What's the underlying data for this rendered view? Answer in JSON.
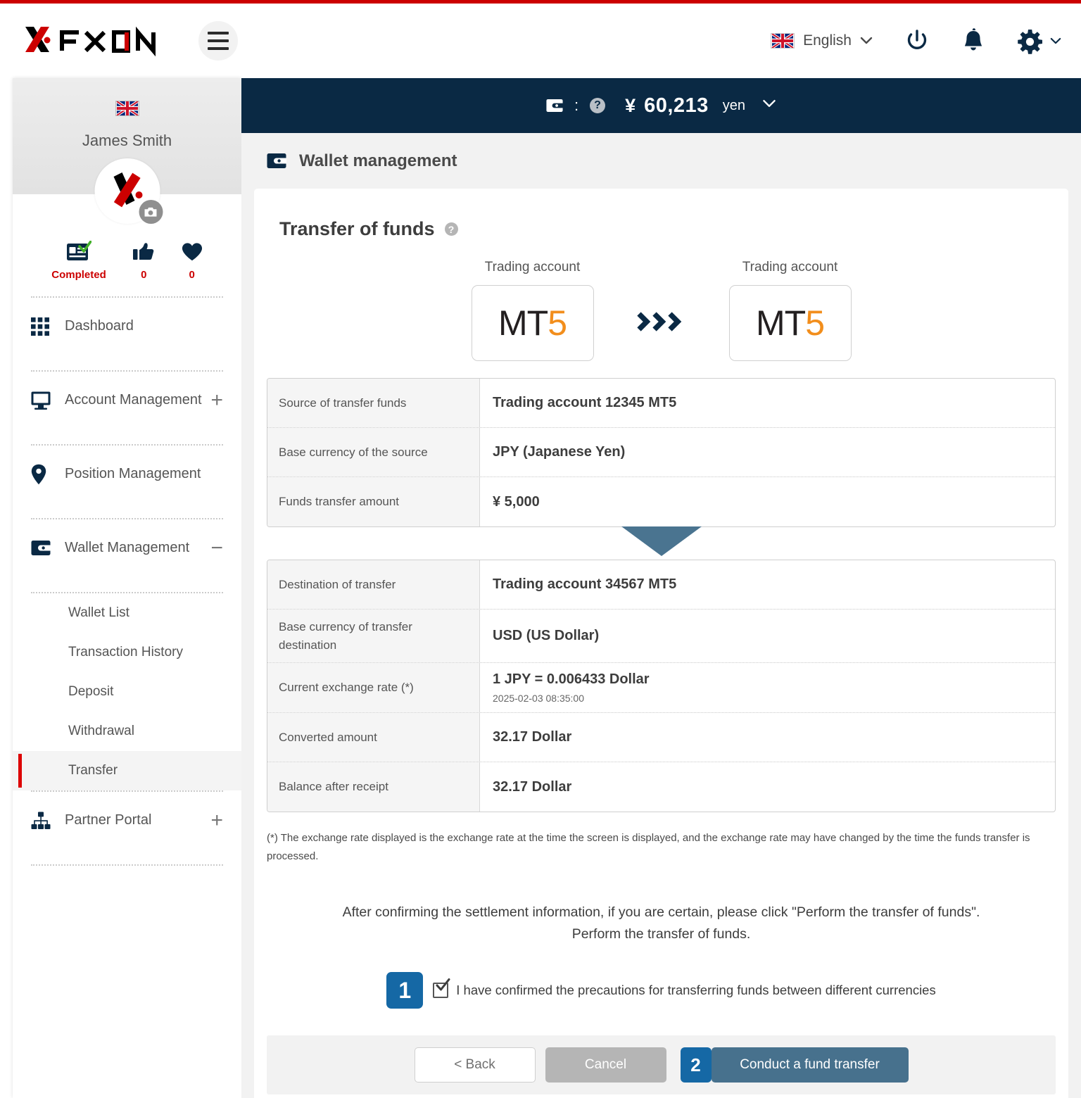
{
  "header": {
    "logo_text": "FXON",
    "menu_icon": "hamburger-icon",
    "language": "English",
    "power_icon": "power-icon",
    "bell_icon": "bell-icon",
    "gear_icon": "gear-icon",
    "flag_icon": "uk-flag-icon"
  },
  "sidebar": {
    "user_name": "James Smith",
    "user_flag": "uk-flag-icon",
    "avatar_icon": "fxon-avatar-icon",
    "camera_icon": "camera-icon",
    "stats": [
      {
        "icon": "id-card-check-icon",
        "label": "Completed"
      },
      {
        "icon": "thumbs-up-icon",
        "label": "0"
      },
      {
        "icon": "heart-icon",
        "label": "0"
      }
    ],
    "nav": [
      {
        "label": "Dashboard",
        "icon": "grid-icon",
        "toggle": ""
      },
      {
        "label": "Account Management",
        "icon": "monitor-icon",
        "toggle": "+"
      },
      {
        "label": "Position Management",
        "icon": "pin-icon",
        "toggle": ""
      },
      {
        "label": "Wallet Management",
        "icon": "wallet-icon",
        "toggle": "−"
      }
    ],
    "sub_items": [
      {
        "label": "Wallet List",
        "active": false
      },
      {
        "label": "Transaction History",
        "active": false
      },
      {
        "label": "Deposit",
        "active": false
      },
      {
        "label": "Withdrawal",
        "active": false
      },
      {
        "label": "Transfer",
        "active": true
      }
    ],
    "nav_bottom": [
      {
        "label": "Partner Portal",
        "icon": "sitemap-icon",
        "toggle": "+"
      }
    ]
  },
  "balance_bar": {
    "wallet_icon": "wallet-icon",
    "colon": ":",
    "help_icon": "question-icon",
    "currency_symbol": "¥",
    "amount": "60,213",
    "unit": "yen",
    "chevron_icon": "chevron-down-icon"
  },
  "page": {
    "breadcrumb_icon": "wallet-icon",
    "breadcrumb_title": "Wallet management",
    "card_title": "Transfer of funds",
    "card_help_icon": "question-icon"
  },
  "flow": {
    "source_label": "Trading account",
    "source_platform_prefix": "MT",
    "source_platform_suffix": "5",
    "arrow_icon": "triple-chevron-right-icon",
    "dest_label": "Trading account",
    "dest_platform_prefix": "MT",
    "dest_platform_suffix": "5"
  },
  "source_table": [
    {
      "key": "Source of transfer funds",
      "value": "Trading account 12345 MT5",
      "sub": ""
    },
    {
      "key": "Base currency of the source",
      "value": "JPY (Japanese Yen)",
      "sub": ""
    },
    {
      "key": "Funds transfer amount",
      "value": "¥ 5,000",
      "sub": ""
    }
  ],
  "dest_table": [
    {
      "key": "Destination of transfer",
      "value": "Trading account 34567 MT5",
      "sub": ""
    },
    {
      "key": "Base currency of transfer destination",
      "value": "USD (US Dollar)",
      "sub": ""
    },
    {
      "key": "Current exchange rate (*)",
      "value": "1 JPY = 0.006433 Dollar",
      "sub": "2025-02-03 08:35:00"
    },
    {
      "key": "Converted amount",
      "value": "32.17 Dollar",
      "sub": ""
    },
    {
      "key": "Balance after receipt",
      "value": "32.17 Dollar",
      "sub": ""
    }
  ],
  "footnote": "(*)  The exchange rate displayed is the exchange rate at the time the screen is displayed, and the exchange rate may have changed by the time the funds transfer is processed.",
  "confirm": {
    "line1": "After confirming the settlement information, if you are certain, please click \"Perform the transfer of funds\".",
    "line2": "Perform the transfer of funds.",
    "step_badge": "1",
    "checkbox_label": "I have confirmed the precautions for transferring funds between different currencies",
    "checkbox_checked": true
  },
  "buttons": {
    "back": "< Back",
    "cancel": "Cancel",
    "step_badge": "2",
    "primary": "Conduct a fund transfer"
  },
  "colors": {
    "brand_red": "#cc0000",
    "navy": "#0a2944",
    "accent_blue": "#1568a5",
    "primary_button": "#47718d",
    "mt5_orange": "#f28e1c"
  }
}
